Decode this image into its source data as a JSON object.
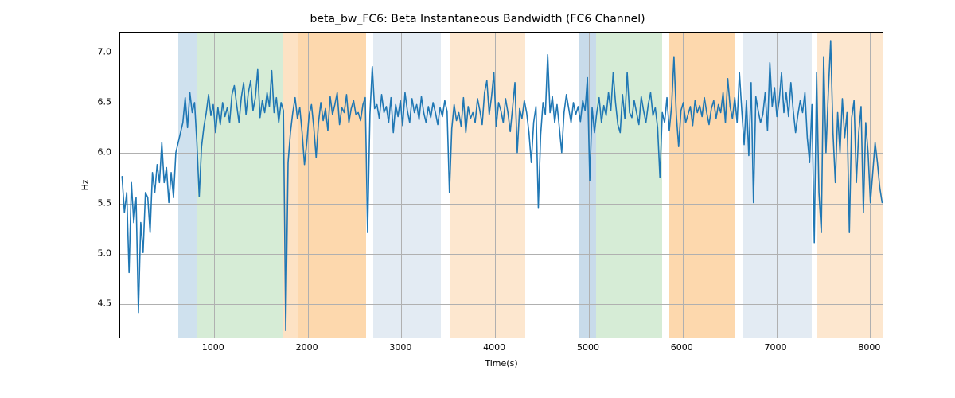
{
  "chart_data": {
    "type": "line",
    "title": "beta_bw_FC6: Beta Instantaneous Bandwidth (FC6 Channel)",
    "xlabel": "Time(s)",
    "ylabel": "Hz",
    "xlim": [
      0,
      8150
    ],
    "ylim": [
      4.15,
      7.2
    ],
    "xticks": [
      1000,
      2000,
      3000,
      4000,
      5000,
      6000,
      7000,
      8000
    ],
    "yticks": [
      4.5,
      5.0,
      5.5,
      6.0,
      6.5,
      7.0
    ],
    "bands": [
      {
        "start": 620,
        "end": 820,
        "color": "#cfe1ee"
      },
      {
        "start": 820,
        "end": 1740,
        "color": "#d6ecd6"
      },
      {
        "start": 1740,
        "end": 1900,
        "color": "#fde2c4"
      },
      {
        "start": 1900,
        "end": 2620,
        "color": "#fdd8ad"
      },
      {
        "start": 2620,
        "end": 2700,
        "color": "#ffffff"
      },
      {
        "start": 2700,
        "end": 3420,
        "color": "#e3ebf3"
      },
      {
        "start": 3420,
        "end": 3520,
        "color": "#ffffff"
      },
      {
        "start": 3520,
        "end": 4320,
        "color": "#fde7cf"
      },
      {
        "start": 4320,
        "end": 4900,
        "color": "#ffffff"
      },
      {
        "start": 4900,
        "end": 5080,
        "color": "#c8dbea"
      },
      {
        "start": 5080,
        "end": 5780,
        "color": "#d6ecd6"
      },
      {
        "start": 5780,
        "end": 5860,
        "color": "#ffffff"
      },
      {
        "start": 5860,
        "end": 6560,
        "color": "#fdd8ad"
      },
      {
        "start": 6560,
        "end": 6640,
        "color": "#ffffff"
      },
      {
        "start": 6640,
        "end": 7380,
        "color": "#e3ebf3"
      },
      {
        "start": 7380,
        "end": 7440,
        "color": "#ffffff"
      },
      {
        "start": 7440,
        "end": 8150,
        "color": "#fde7cf"
      }
    ],
    "series": [
      {
        "name": "beta_bw_FC6",
        "color": "#1f77b4",
        "x": [
          20,
          45,
          70,
          95,
          120,
          145,
          170,
          195,
          220,
          245,
          270,
          295,
          320,
          345,
          370,
          395,
          420,
          445,
          470,
          495,
          520,
          545,
          570,
          595,
          620,
          645,
          670,
          695,
          720,
          745,
          770,
          795,
          820,
          845,
          870,
          895,
          920,
          945,
          970,
          995,
          1020,
          1045,
          1070,
          1095,
          1120,
          1145,
          1170,
          1195,
          1220,
          1245,
          1270,
          1295,
          1320,
          1345,
          1370,
          1395,
          1420,
          1445,
          1470,
          1495,
          1520,
          1545,
          1570,
          1595,
          1620,
          1645,
          1670,
          1695,
          1720,
          1745,
          1770,
          1795,
          1820,
          1845,
          1870,
          1895,
          1920,
          1945,
          1970,
          1995,
          2020,
          2045,
          2070,
          2095,
          2120,
          2145,
          2170,
          2195,
          2220,
          2245,
          2270,
          2295,
          2320,
          2345,
          2370,
          2395,
          2420,
          2445,
          2470,
          2495,
          2520,
          2545,
          2570,
          2595,
          2620,
          2645,
          2670,
          2695,
          2720,
          2745,
          2770,
          2795,
          2820,
          2845,
          2870,
          2895,
          2920,
          2945,
          2970,
          2995,
          3020,
          3045,
          3070,
          3095,
          3120,
          3145,
          3170,
          3195,
          3220,
          3245,
          3270,
          3295,
          3320,
          3345,
          3370,
          3395,
          3420,
          3445,
          3470,
          3495,
          3520,
          3545,
          3570,
          3595,
          3620,
          3645,
          3670,
          3695,
          3720,
          3745,
          3770,
          3795,
          3820,
          3845,
          3870,
          3895,
          3920,
          3945,
          3970,
          3995,
          4020,
          4045,
          4070,
          4095,
          4120,
          4145,
          4170,
          4195,
          4220,
          4245,
          4270,
          4295,
          4320,
          4345,
          4370,
          4395,
          4420,
          4445,
          4470,
          4495,
          4520,
          4545,
          4570,
          4595,
          4620,
          4645,
          4670,
          4695,
          4720,
          4745,
          4770,
          4795,
          4820,
          4845,
          4870,
          4895,
          4920,
          4945,
          4970,
          4995,
          5020,
          5045,
          5070,
          5095,
          5120,
          5145,
          5170,
          5195,
          5220,
          5245,
          5270,
          5295,
          5320,
          5345,
          5370,
          5395,
          5420,
          5445,
          5470,
          5495,
          5520,
          5545,
          5570,
          5595,
          5620,
          5645,
          5670,
          5695,
          5720,
          5745,
          5770,
          5795,
          5820,
          5845,
          5870,
          5895,
          5920,
          5945,
          5970,
          5995,
          6020,
          6045,
          6070,
          6095,
          6120,
          6145,
          6170,
          6195,
          6220,
          6245,
          6270,
          6295,
          6320,
          6345,
          6370,
          6395,
          6420,
          6445,
          6470,
          6495,
          6520,
          6545,
          6570,
          6595,
          6620,
          6645,
          6670,
          6695,
          6720,
          6745,
          6770,
          6795,
          6820,
          6845,
          6870,
          6895,
          6920,
          6945,
          6970,
          6995,
          7020,
          7045,
          7070,
          7095,
          7120,
          7145,
          7170,
          7195,
          7220,
          7245,
          7270,
          7295,
          7320,
          7345,
          7370,
          7395,
          7420,
          7445,
          7470,
          7495,
          7520,
          7545,
          7570,
          7595,
          7620,
          7645,
          7670,
          7695,
          7720,
          7745,
          7770,
          7795,
          7820,
          7845,
          7870,
          7895,
          7920,
          7945,
          7970,
          7995,
          8020,
          8045,
          8070,
          8095,
          8120,
          8145
        ],
        "y": [
          5.76,
          5.4,
          5.6,
          4.8,
          5.7,
          5.3,
          5.55,
          4.4,
          5.3,
          5.0,
          5.6,
          5.55,
          5.2,
          5.8,
          5.6,
          5.88,
          5.7,
          6.1,
          5.7,
          5.85,
          5.5,
          5.8,
          5.55,
          6.0,
          6.1,
          6.2,
          6.3,
          6.55,
          6.25,
          6.6,
          6.4,
          6.5,
          6.1,
          5.56,
          6.06,
          6.26,
          6.4,
          6.58,
          6.37,
          6.48,
          6.2,
          6.45,
          6.28,
          6.5,
          6.36,
          6.45,
          6.3,
          6.58,
          6.67,
          6.48,
          6.3,
          6.55,
          6.7,
          6.38,
          6.6,
          6.72,
          6.42,
          6.55,
          6.83,
          6.35,
          6.52,
          6.4,
          6.6,
          6.46,
          6.82,
          6.4,
          6.55,
          6.3,
          6.5,
          6.42,
          4.22,
          5.9,
          6.2,
          6.4,
          6.55,
          6.34,
          6.45,
          6.2,
          5.88,
          6.1,
          6.38,
          6.48,
          6.25,
          5.95,
          6.3,
          6.5,
          6.32,
          6.44,
          6.22,
          6.56,
          6.38,
          6.48,
          6.6,
          6.28,
          6.45,
          6.4,
          6.58,
          6.3,
          6.44,
          6.52,
          6.38,
          6.4,
          6.32,
          6.48,
          6.55,
          5.2,
          6.38,
          6.86,
          6.44,
          6.48,
          6.34,
          6.58,
          6.4,
          6.46,
          6.3,
          6.55,
          6.2,
          6.48,
          6.36,
          6.52,
          6.27,
          6.6,
          6.42,
          6.3,
          6.54,
          6.4,
          6.48,
          6.33,
          6.56,
          6.4,
          6.3,
          6.46,
          6.35,
          6.5,
          6.4,
          6.28,
          6.45,
          6.36,
          6.52,
          6.41,
          5.6,
          6.24,
          6.48,
          6.32,
          6.4,
          6.26,
          6.55,
          6.2,
          6.46,
          6.34,
          6.4,
          6.3,
          6.54,
          6.42,
          6.28,
          6.6,
          6.72,
          6.38,
          6.56,
          6.8,
          6.26,
          6.5,
          6.42,
          6.3,
          6.54,
          6.4,
          6.21,
          6.45,
          6.7,
          6.0,
          6.44,
          6.34,
          6.52,
          6.4,
          6.2,
          5.9,
          6.3,
          6.46,
          5.45,
          6.18,
          6.5,
          6.38,
          6.98,
          6.4,
          6.56,
          6.3,
          6.48,
          6.25,
          6.0,
          6.4,
          6.58,
          6.44,
          6.3,
          6.5,
          6.38,
          6.46,
          6.31,
          6.52,
          6.42,
          6.75,
          5.72,
          6.45,
          6.2,
          6.4,
          6.55,
          6.3,
          6.47,
          6.37,
          6.6,
          6.42,
          6.8,
          6.5,
          6.28,
          6.2,
          6.58,
          6.34,
          6.8,
          6.4,
          6.35,
          6.52,
          6.4,
          6.28,
          6.56,
          6.42,
          6.3,
          6.48,
          6.6,
          6.37,
          6.45,
          6.25,
          5.75,
          6.4,
          6.3,
          6.55,
          6.22,
          6.47,
          6.96,
          6.38,
          6.06,
          6.42,
          6.5,
          6.3,
          6.38,
          6.46,
          6.27,
          6.52,
          6.4,
          6.47,
          6.36,
          6.55,
          6.4,
          6.28,
          6.44,
          6.52,
          6.34,
          6.48,
          6.4,
          6.6,
          6.3,
          6.74,
          6.46,
          6.34,
          6.55,
          6.3,
          6.8,
          6.42,
          6.08,
          6.52,
          5.97,
          6.7,
          5.5,
          6.56,
          6.42,
          6.3,
          6.38,
          6.6,
          6.22,
          6.9,
          6.46,
          6.65,
          6.36,
          6.52,
          6.8,
          6.4,
          6.6,
          6.36,
          6.7,
          6.42,
          6.2,
          6.38,
          6.52,
          6.4,
          6.6,
          6.15,
          5.9,
          6.48,
          5.1,
          6.8,
          5.6,
          5.2,
          6.96,
          6.0,
          6.6,
          7.12,
          6.2,
          5.7,
          6.4,
          6.0,
          6.54,
          6.15,
          6.4,
          5.2,
          6.35,
          6.52,
          5.7,
          6.2,
          6.46,
          5.4,
          6.3,
          6.0,
          5.5,
          5.8,
          6.1,
          5.9,
          5.65,
          5.5
        ]
      }
    ]
  }
}
